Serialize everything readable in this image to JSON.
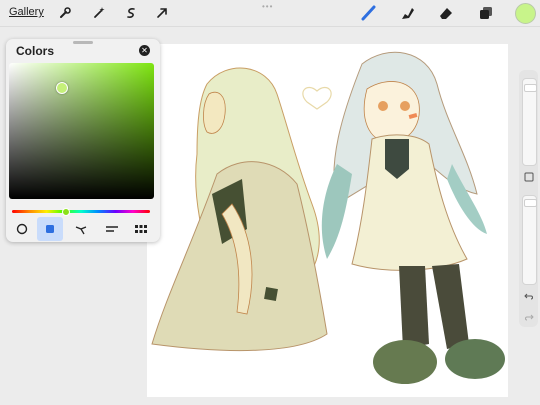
{
  "toolbar": {
    "gallery_label": "Gallery",
    "left_tools": [
      "wrench-icon",
      "magic-wand-icon",
      "selection-icon",
      "transform-arrow-icon"
    ],
    "right_tools": [
      "brush-icon",
      "smudge-icon",
      "eraser-icon",
      "layers-icon"
    ],
    "current_color": "#c8f48a",
    "accent": "#2e6fe0"
  },
  "colors_panel": {
    "title": "Colors",
    "selected_color": "#c5f07a",
    "hue_color": "#7ee510",
    "tabs": [
      "disc-tab",
      "classic-tab",
      "harmony-tab",
      "value-tab",
      "palettes-tab"
    ],
    "active_tab": "classic-tab"
  },
  "sidebar": {
    "buttons": [
      "modify-button-square",
      "undo-icon",
      "redo-icon"
    ]
  },
  "canvas": {
    "artwork": "two-girls-sketch"
  }
}
